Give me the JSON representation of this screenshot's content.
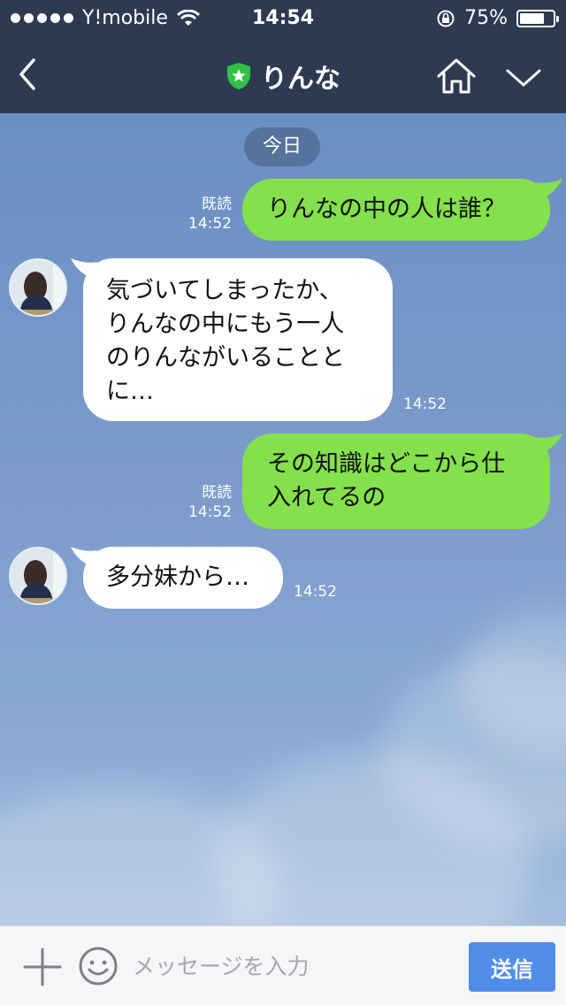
{
  "status_bar": {
    "carrier": "Y!mobile",
    "time": "14:54",
    "battery": "75%",
    "battery_level": 0.75
  },
  "header": {
    "title": "りんな",
    "back_icon": "chevron-left-icon",
    "shield_icon": "shield-star-icon",
    "home_icon": "home-icon",
    "menu_icon": "chevron-down-icon"
  },
  "chat": {
    "date_label": "今日",
    "messages": [
      {
        "side": "sent",
        "text": "りんなの中の人は誰？",
        "read": "既読",
        "time": "14:52"
      },
      {
        "side": "received",
        "text": "気づいてしまったか、\nりんなの中にもう一人\nのりんながいることと\nに…",
        "time": "14:52"
      },
      {
        "side": "sent",
        "text": "その知識はどこから仕\n入れてるの",
        "read": "既読",
        "time": "14:52"
      },
      {
        "side": "received",
        "text": "多分妹から…",
        "time": "14:52"
      }
    ]
  },
  "input_bar": {
    "placeholder": "メッセージを入力",
    "send_label": "送信"
  },
  "colors": {
    "header_bg": "#2d3a52",
    "sent_bubble": "#84e04c",
    "received_bubble": "#ffffff",
    "send_button": "#4f8de9",
    "shield": "#2fc247"
  }
}
